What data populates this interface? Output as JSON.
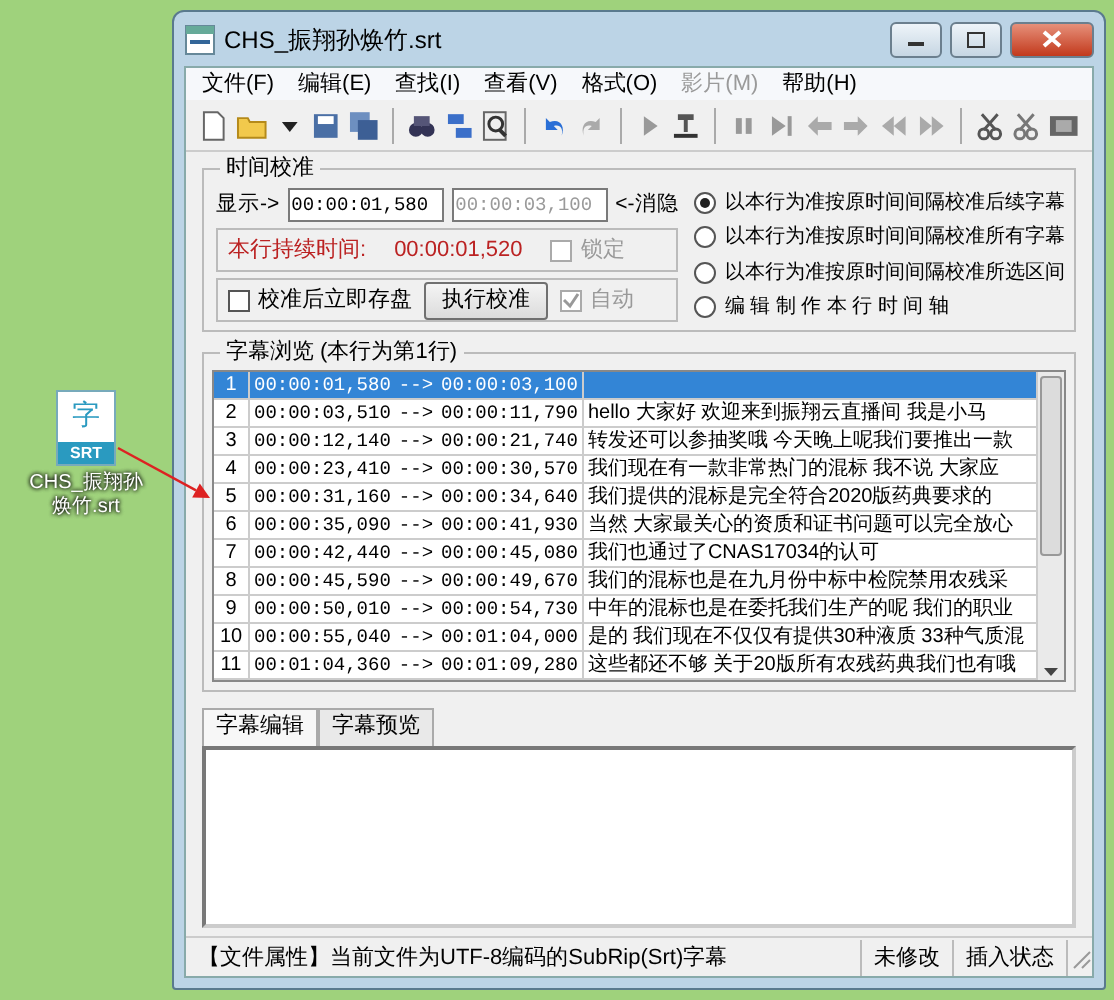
{
  "desktop_icon": {
    "glyph": "字",
    "badge": "SRT",
    "label": "CHS_振翔孙焕竹.srt"
  },
  "window": {
    "title": "CHS_振翔孙焕竹.srt"
  },
  "menu": [
    {
      "label": "文件(F)",
      "disabled": false
    },
    {
      "label": "编辑(E)",
      "disabled": false
    },
    {
      "label": "查找(I)",
      "disabled": false
    },
    {
      "label": "查看(V)",
      "disabled": false
    },
    {
      "label": "格式(O)",
      "disabled": false
    },
    {
      "label": "影片(M)",
      "disabled": true
    },
    {
      "label": "帮助(H)",
      "disabled": false
    }
  ],
  "time_calibration": {
    "title": "时间校准",
    "show_label": "显示->",
    "start_field": {
      "value": "00:00:01,580",
      "disabled": false
    },
    "end_field": {
      "value": "00:00:03,100",
      "disabled": true
    },
    "hide_label": "<-消隐",
    "duration_label": "本行持续时间:",
    "duration": "00:00:01,520",
    "lock": {
      "label": "锁定",
      "checked": false,
      "disabled": true
    },
    "save_after": {
      "label": "校准后立即存盘",
      "checked": false,
      "disabled": false
    },
    "run_button": "执行校准",
    "auto": {
      "label": "自动",
      "checked": true,
      "disabled": true
    },
    "modes": [
      {
        "label": "以本行为准按原时间间隔校准后续字幕",
        "selected": true
      },
      {
        "label": "以本行为准按原时间间隔校准所有字幕",
        "selected": false
      },
      {
        "label": "以本行为准按原时间间隔校准所选区间",
        "selected": false
      },
      {
        "label": "编 辑 制 作 本 行 时 间 轴",
        "selected": false
      }
    ]
  },
  "subtitle_browser": {
    "title": "字幕浏览 (本行为第1行)",
    "rows": [
      {
        "index": "1",
        "start": "00:00:01,580",
        "arrow": "-->",
        "end": "00:00:03,100",
        "selected": true
      },
      {
        "index": "2",
        "start": "00:00:03,510",
        "arrow": "-->",
        "end": "00:00:11,790",
        "text": "hello 大家好 欢迎来到振翔云直播间 我是小马",
        "selected": false
      },
      {
        "index": "3",
        "start": "00:00:12,140",
        "arrow": "-->",
        "end": "00:00:21,740",
        "text": "转发还可以参抽奖哦 今天晚上呢我们要推出一款",
        "selected": false
      },
      {
        "index": "4",
        "start": "00:00:23,410",
        "arrow": "-->",
        "end": "00:00:30,570",
        "text": "我们现在有一款非常热门的混标 我不说 大家应",
        "selected": false
      },
      {
        "index": "5",
        "start": "00:00:31,160",
        "arrow": "-->",
        "end": "00:00:34,640",
        "text": "我们提供的混标是完全符合2020版药典要求的",
        "selected": false
      },
      {
        "index": "6",
        "start": "00:00:35,090",
        "arrow": "-->",
        "end": "00:00:41,930",
        "text": "当然 大家最关心的资质和证书问题可以完全放心",
        "selected": false
      },
      {
        "index": "7",
        "start": "00:00:42,440",
        "arrow": "-->",
        "end": "00:00:45,080",
        "text": "我们也通过了CNAS17034的认可",
        "selected": false
      },
      {
        "index": "8",
        "start": "00:00:45,590",
        "arrow": "-->",
        "end": "00:00:49,670",
        "text": "我们的混标也是在九月份中标中检院禁用农残采",
        "selected": false
      },
      {
        "index": "9",
        "start": "00:00:50,010",
        "arrow": "-->",
        "end": "00:00:54,730",
        "text": "中年的混标也是在委托我们生产的呢 我们的职业",
        "selected": false
      },
      {
        "index": "10",
        "start": "00:00:55,040",
        "arrow": "-->",
        "end": "00:01:04,000",
        "text": "是的 我们现在不仅仅有提供30种液质 33种气质混",
        "selected": false
      },
      {
        "index": "11",
        "start": "00:01:04,360",
        "arrow": "-->",
        "end": "00:01:09,280",
        "text": "这些都还不够 关于20版所有农残药典我们也有哦",
        "selected": false
      }
    ]
  },
  "edit_tabs": [
    {
      "label": "字幕编辑",
      "selected": true
    },
    {
      "label": "字幕预览",
      "selected": false
    }
  ],
  "status_bar": {
    "file_info": "【文件属性】当前文件为UTF-8编码的SubRip(Srt)字幕",
    "modified": "未修改",
    "mode": "插入状态"
  }
}
